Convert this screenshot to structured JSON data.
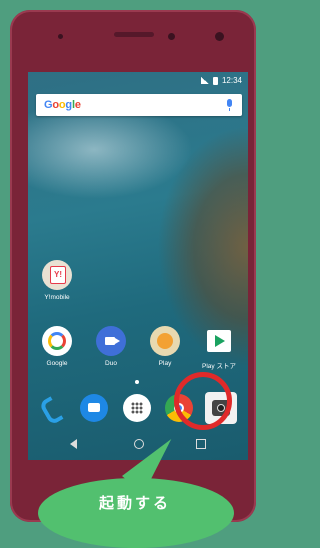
{
  "status_bar": {
    "time": "12:34"
  },
  "search": {
    "logo_parts": [
      "G",
      "o",
      "o",
      "g",
      "l",
      "e"
    ]
  },
  "home": {
    "row1": [
      {
        "label": "Y!mobile",
        "badge": "Y!"
      }
    ],
    "row2": [
      {
        "label": "Google"
      },
      {
        "label": "Duo"
      },
      {
        "label": "Play"
      },
      {
        "label": "Play ストア"
      }
    ]
  },
  "callout": {
    "text": "起動する"
  },
  "colors": {
    "highlight": "#e02a2a",
    "callout": "#52c06f",
    "frame": "#7a2438"
  }
}
